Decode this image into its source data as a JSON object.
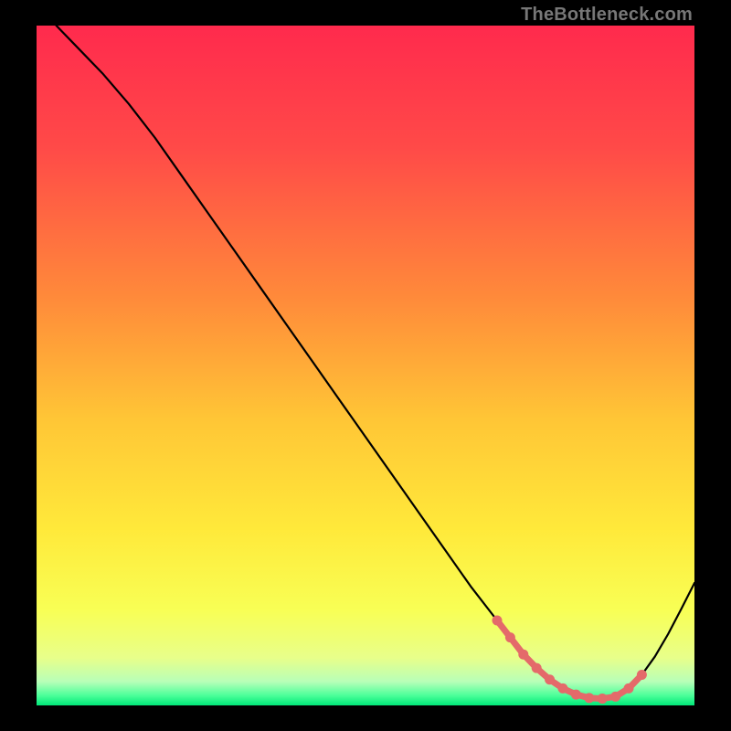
{
  "chart_data": {
    "type": "line",
    "title": "",
    "xlabel": "",
    "ylabel": "",
    "watermark": "TheBottleneck.com",
    "x_range": [
      0,
      100
    ],
    "y_range": [
      0,
      100
    ],
    "gradient_stops": [
      {
        "offset": 0.0,
        "color": "#ff2a4d"
      },
      {
        "offset": 0.18,
        "color": "#ff4a48"
      },
      {
        "offset": 0.4,
        "color": "#ff8a3a"
      },
      {
        "offset": 0.58,
        "color": "#ffc636"
      },
      {
        "offset": 0.74,
        "color": "#ffe93a"
      },
      {
        "offset": 0.86,
        "color": "#f8ff55"
      },
      {
        "offset": 0.93,
        "color": "#e8ff8a"
      },
      {
        "offset": 0.965,
        "color": "#b8ffb8"
      },
      {
        "offset": 0.985,
        "color": "#4dff9a"
      },
      {
        "offset": 1.0,
        "color": "#00e878"
      }
    ],
    "series": [
      {
        "name": "bottleneck-curve",
        "color": "#000000",
        "width": 2.2,
        "x": [
          3,
          6,
          10,
          14,
          18,
          22,
          26,
          30,
          34,
          38,
          42,
          46,
          50,
          54,
          58,
          62,
          66,
          70,
          72,
          74,
          76,
          78,
          80,
          82,
          84,
          86,
          88,
          90,
          92,
          94,
          96,
          98,
          100
        ],
        "y": [
          100,
          97,
          93,
          88.5,
          83.5,
          78,
          72.5,
          67,
          61.5,
          56,
          50.5,
          45,
          39.5,
          34,
          28.5,
          23,
          17.5,
          12.5,
          10,
          7.5,
          5.5,
          3.8,
          2.5,
          1.6,
          1.1,
          1.0,
          1.3,
          2.5,
          4.5,
          7.2,
          10.5,
          14.2,
          18
        ]
      }
    ],
    "highlight": {
      "name": "optimal-band",
      "color": "#e46a6a",
      "dot_radius": 5.5,
      "line_width": 7,
      "x": [
        70,
        72,
        74,
        76,
        78,
        80,
        82,
        84,
        86,
        88,
        90,
        92
      ],
      "y": [
        12.5,
        10,
        7.5,
        5.5,
        3.8,
        2.5,
        1.6,
        1.1,
        1.0,
        1.3,
        2.5,
        4.5
      ]
    }
  }
}
